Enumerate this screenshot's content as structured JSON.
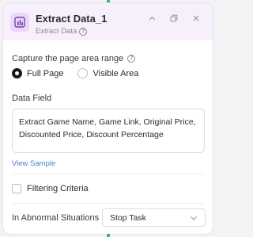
{
  "node": {
    "title": "Extract Data_1",
    "subtitle": "Extract Data",
    "icon": "table-chart-icon",
    "header_actions": [
      "chevron-up-icon",
      "copy-icon",
      "close-icon"
    ]
  },
  "capture": {
    "label": "Capture the page area range",
    "options": [
      "Full Page",
      "Visible Area"
    ],
    "selected": "Full Page"
  },
  "data_field": {
    "label": "Data Field",
    "value": "Extract Game Name, Game Link, Original Price, Discounted Price, Discount Percentage",
    "view_sample": "View Sample"
  },
  "filtering": {
    "label": "Filtering Criteria",
    "checked": false
  },
  "abnormal": {
    "label": "In Abnormal Situations",
    "selected": "Stop Task"
  },
  "colors": {
    "accent": "#2bb673",
    "header_bg": "#f7effc",
    "icon_bg": "#ead8f8",
    "link": "#4a7fd4"
  }
}
